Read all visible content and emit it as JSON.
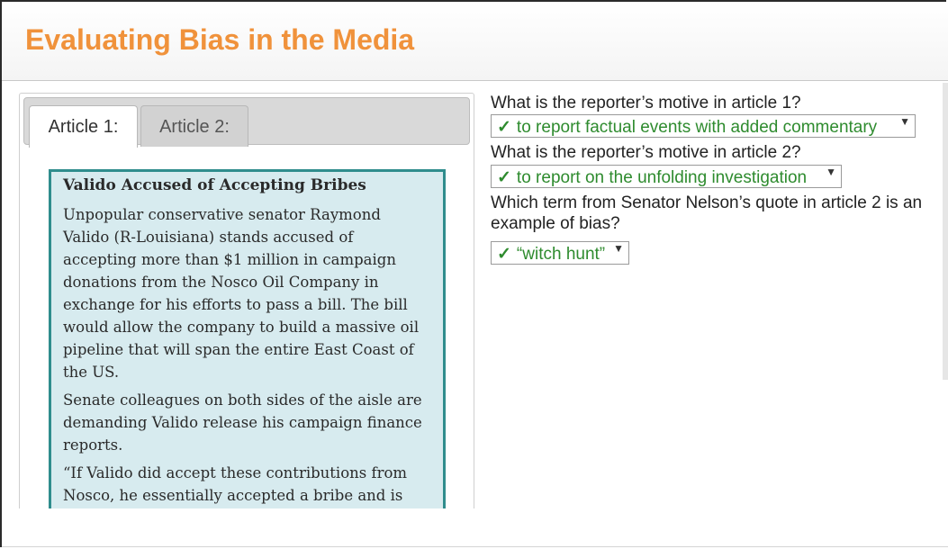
{
  "header": {
    "title": "Evaluating Bias in the Media"
  },
  "tabs": [
    {
      "label": "Article 1:"
    },
    {
      "label": "Article 2:"
    }
  ],
  "article": {
    "headline": "Valido Accused of Accepting Bribes",
    "paragraphs": [
      "Unpopular conservative senator Raymond Valido (R-Louisiana) stands accused of accepting more than $1 million in campaign donations from the Nosco Oil Company in exchange for his efforts to pass a bill. The bill would allow the company to build a massive oil pipeline that will span the entire East Coast of the US.",
      "Senate colleagues on both sides of the aisle are demanding Valido release his campaign finance reports.",
      "“If Valido did accept these contributions from Nosco, he essentially accepted a bribe and is now fulfilling his part of the bargain,” said Senator"
    ]
  },
  "questions": [
    {
      "text": "What is the reporter’s motive in article 1?",
      "answer": "to report factual events with added commentary",
      "check": "✓",
      "caret": "▼"
    },
    {
      "text": "What is the reporter’s motive in article 2?",
      "answer": "to report on the unfolding investigation",
      "check": "✓",
      "caret": "▼"
    },
    {
      "text": "Which term from Senator Nelson’s quote in article 2 is an example of bias?",
      "answer": "“witch hunt”",
      "check": "✓",
      "caret": "▼"
    }
  ],
  "colors": {
    "title": "#f0923b",
    "correct": "#2e8b2e",
    "article_bg": "#d7ebef",
    "article_border": "#2f8d8d"
  }
}
